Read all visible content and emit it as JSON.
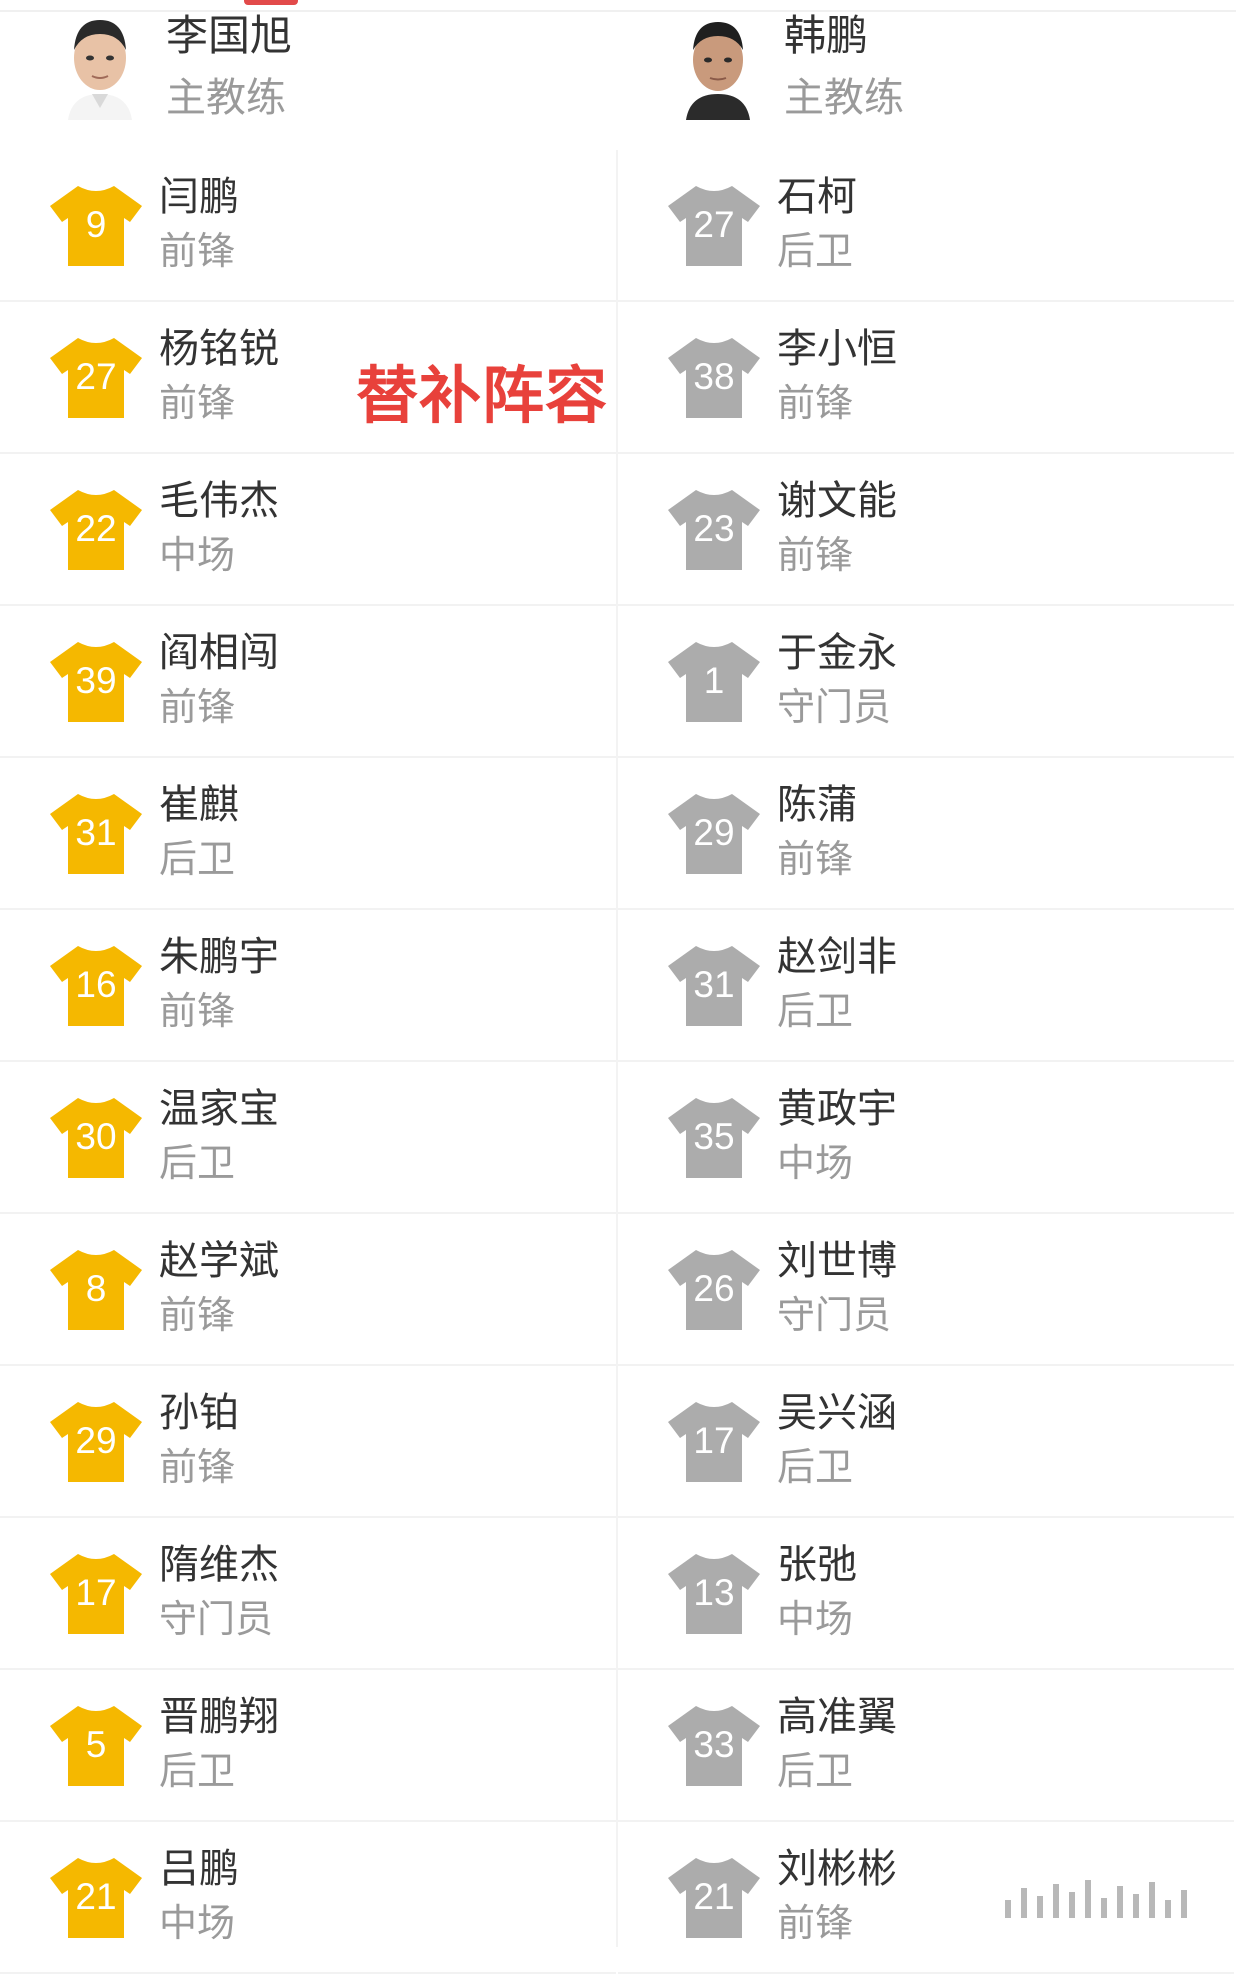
{
  "overlay_title": "替补阵容",
  "colors": {
    "home_shirt": "#f5b800",
    "away_shirt": "#acacac",
    "overlay": "#e8413b"
  },
  "home": {
    "coach": {
      "name": "李国旭",
      "role": "主教练"
    },
    "players": [
      {
        "number": "9",
        "name": "闫鹏",
        "position": "前锋"
      },
      {
        "number": "27",
        "name": "杨铭锐",
        "position": "前锋"
      },
      {
        "number": "22",
        "name": "毛伟杰",
        "position": "中场"
      },
      {
        "number": "39",
        "name": "阎相闯",
        "position": "前锋"
      },
      {
        "number": "31",
        "name": "崔麒",
        "position": "后卫"
      },
      {
        "number": "16",
        "name": "朱鹏宇",
        "position": "前锋"
      },
      {
        "number": "30",
        "name": "温家宝",
        "position": "后卫"
      },
      {
        "number": "8",
        "name": "赵学斌",
        "position": "前锋"
      },
      {
        "number": "29",
        "name": "孙铂",
        "position": "前锋"
      },
      {
        "number": "17",
        "name": "隋维杰",
        "position": "守门员"
      },
      {
        "number": "5",
        "name": "晋鹏翔",
        "position": "后卫"
      },
      {
        "number": "21",
        "name": "吕鹏",
        "position": "中场"
      }
    ]
  },
  "away": {
    "coach": {
      "name": "韩鹏",
      "role": "主教练"
    },
    "players": [
      {
        "number": "27",
        "name": "石柯",
        "position": "后卫"
      },
      {
        "number": "38",
        "name": "李小恒",
        "position": "前锋"
      },
      {
        "number": "23",
        "name": "谢文能",
        "position": "前锋"
      },
      {
        "number": "1",
        "name": "于金永",
        "position": "守门员"
      },
      {
        "number": "29",
        "name": "陈蒲",
        "position": "前锋"
      },
      {
        "number": "31",
        "name": "赵剑非",
        "position": "后卫"
      },
      {
        "number": "35",
        "name": "黄政宇",
        "position": "中场"
      },
      {
        "number": "26",
        "name": "刘世博",
        "position": "守门员"
      },
      {
        "number": "17",
        "name": "吴兴涵",
        "position": "后卫"
      },
      {
        "number": "13",
        "name": "张弛",
        "position": "中场"
      },
      {
        "number": "33",
        "name": "高准翼",
        "position": "后卫"
      },
      {
        "number": "21",
        "name": "刘彬彬",
        "position": "前锋"
      }
    ]
  }
}
